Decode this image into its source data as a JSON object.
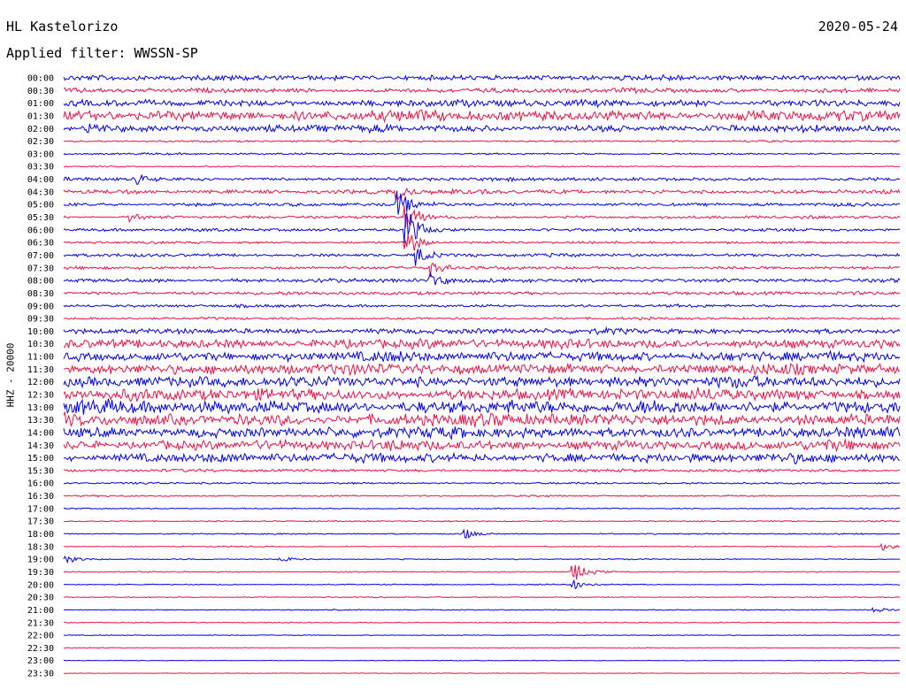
{
  "header": {
    "station": "HL Kastelorizo",
    "date": "2020-05-24",
    "filter_label": "Applied filter: WWSSN-SP"
  },
  "chart_data": {
    "type": "line",
    "subtype": "helicorder",
    "ylabel": "HHZ - 20000",
    "row_labels": [
      "00:00",
      "00:30",
      "01:00",
      "01:30",
      "02:00",
      "02:30",
      "03:00",
      "03:30",
      "04:00",
      "04:30",
      "05:00",
      "05:30",
      "06:00",
      "06:30",
      "07:00",
      "07:30",
      "08:00",
      "08:30",
      "09:00",
      "09:30",
      "10:00",
      "10:30",
      "11:00",
      "11:30",
      "12:00",
      "12:30",
      "13:00",
      "13:30",
      "14:00",
      "14:30",
      "15:00",
      "15:30",
      "16:00",
      "16:30",
      "17:00",
      "17:30",
      "18:00",
      "18:30",
      "19:00",
      "19:30",
      "20:00",
      "20:30",
      "21:00",
      "21:30",
      "22:00",
      "22:30",
      "23:00",
      "23:30"
    ],
    "colors": [
      "#0000ee",
      "#ee1144"
    ],
    "noise_amplitude": [
      0.35,
      0.3,
      0.45,
      0.7,
      0.45,
      0.12,
      0.12,
      0.08,
      0.22,
      0.28,
      0.22,
      0.18,
      0.2,
      0.15,
      0.2,
      0.2,
      0.25,
      0.22,
      0.18,
      0.15,
      0.35,
      0.6,
      0.65,
      0.7,
      0.7,
      0.75,
      0.85,
      0.8,
      0.7,
      0.65,
      0.6,
      0.18,
      0.12,
      0.1,
      0.08,
      0.08,
      0.08,
      0.06,
      0.07,
      0.08,
      0.07,
      0.06,
      0.07,
      0.06,
      0.05,
      0.05,
      0.04,
      0.04
    ],
    "events": [
      {
        "row": 4,
        "x": 0.03,
        "amplitude": 0.9
      },
      {
        "row": 8,
        "x": 0.09,
        "amplitude": 0.7
      },
      {
        "row": 11,
        "x": 0.08,
        "amplitude": 0.8
      },
      {
        "row": 9,
        "x": 0.4,
        "amplitude": 1.2
      },
      {
        "row": 10,
        "x": 0.4,
        "amplitude": 2.6
      },
      {
        "row": 11,
        "x": 0.41,
        "amplitude": 3.6
      },
      {
        "row": 12,
        "x": 0.41,
        "amplitude": 4.2
      },
      {
        "row": 13,
        "x": 0.41,
        "amplitude": 3.0
      },
      {
        "row": 14,
        "x": 0.42,
        "amplitude": 2.0
      },
      {
        "row": 15,
        "x": 0.44,
        "amplitude": 1.6
      },
      {
        "row": 16,
        "x": 0.44,
        "amplitude": 1.2
      },
      {
        "row": 36,
        "x": 0.48,
        "amplitude": 0.9
      },
      {
        "row": 37,
        "x": 0.98,
        "amplitude": 0.9
      },
      {
        "row": 38,
        "x": 0.0,
        "amplitude": 1.1
      },
      {
        "row": 38,
        "x": 0.26,
        "amplitude": 0.5
      },
      {
        "row": 39,
        "x": 0.61,
        "amplitude": 1.8
      },
      {
        "row": 40,
        "x": 0.61,
        "amplitude": 1.0
      },
      {
        "row": 42,
        "x": 0.97,
        "amplitude": 0.5
      }
    ]
  }
}
